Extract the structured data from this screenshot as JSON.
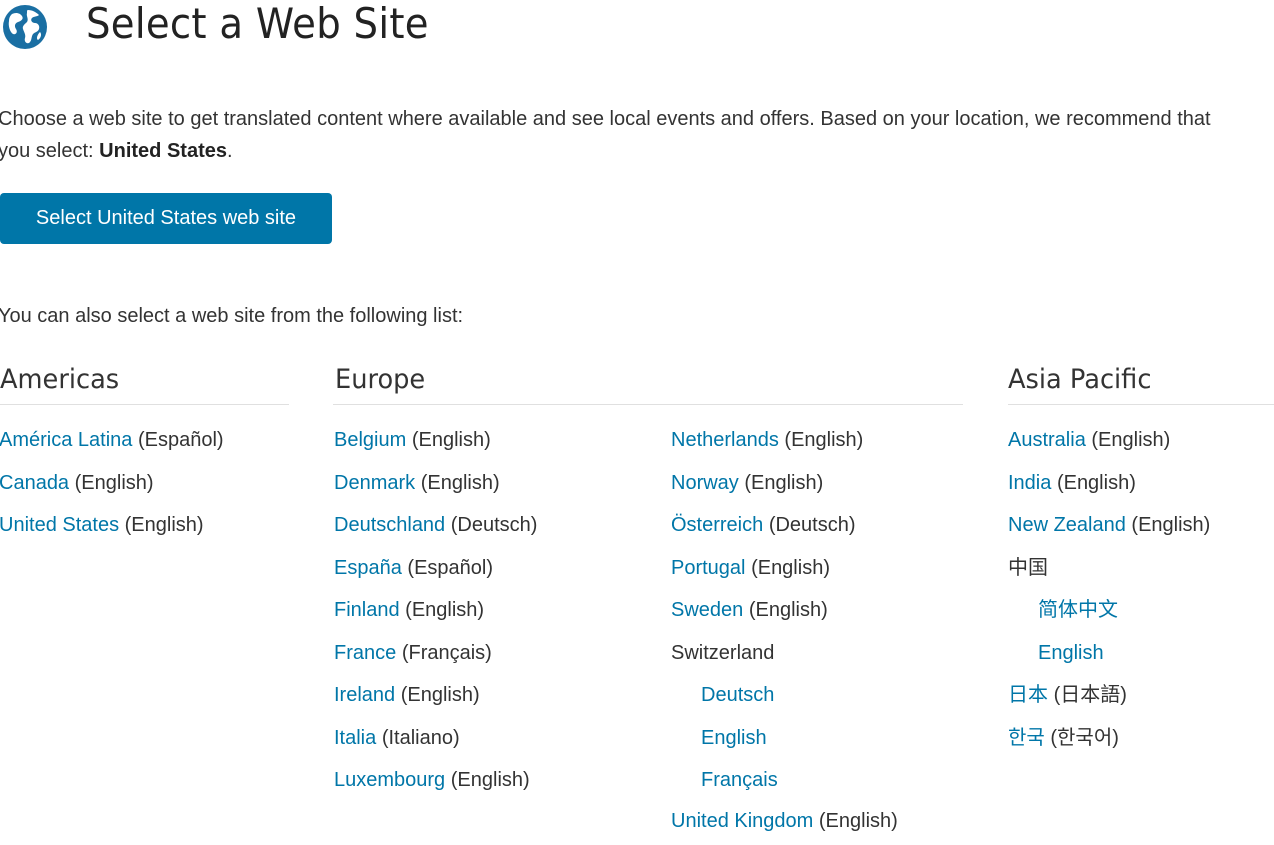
{
  "header": {
    "title": "Select a Web Site",
    "icon": "globe-icon"
  },
  "intro": {
    "text_before": "Choose a web site to get translated content where available and see local events and offers. Based on your location, we recommend that you select: ",
    "recommended": "United States",
    "text_after": "."
  },
  "primary_button": {
    "label": "Select United States web site"
  },
  "list_intro": "You can also select a web site from the following list:",
  "regions": {
    "americas": {
      "title": "Americas",
      "items": [
        {
          "site": "América Latina",
          "lang": "(Español)"
        },
        {
          "site": "Canada",
          "lang": "(English)"
        },
        {
          "site": "United States",
          "lang": "(English)"
        }
      ]
    },
    "europe": {
      "title": "Europe",
      "col1": [
        {
          "site": "Belgium",
          "lang": "(English)"
        },
        {
          "site": "Denmark",
          "lang": "(English)"
        },
        {
          "site": "Deutschland",
          "lang": "(Deutsch)"
        },
        {
          "site": "España",
          "lang": "(Español)"
        },
        {
          "site": "Finland",
          "lang": "(English)"
        },
        {
          "site": "France",
          "lang": "(Français)"
        },
        {
          "site": "Ireland",
          "lang": "(English)"
        },
        {
          "site": "Italia",
          "lang": "(Italiano)"
        },
        {
          "site": "Luxembourg",
          "lang": "(English)"
        }
      ],
      "col2": [
        {
          "site": "Netherlands",
          "lang": "(English)"
        },
        {
          "site": "Norway",
          "lang": "(English)"
        },
        {
          "site": "Österreich",
          "lang": "(Deutsch)"
        },
        {
          "site": "Portugal",
          "lang": "(English)"
        },
        {
          "site": "Sweden",
          "lang": "(English)"
        }
      ],
      "switzerland": {
        "label": "Switzerland",
        "options": [
          "Deutsch",
          "English",
          "Français"
        ]
      },
      "uk": {
        "site": "United Kingdom",
        "lang": "(English)"
      }
    },
    "asia_pacific": {
      "title": "Asia Pacific",
      "items": [
        {
          "site": "Australia",
          "lang": "(English)"
        },
        {
          "site": "India",
          "lang": "(English)"
        },
        {
          "site": "New Zealand",
          "lang": "(English)"
        }
      ],
      "china": {
        "label": "中国",
        "options": [
          "简体中文",
          "English"
        ]
      },
      "items2": [
        {
          "site": "日本",
          "lang": "(日本語)"
        },
        {
          "site": "한국",
          "lang": "(한국어)"
        }
      ]
    }
  },
  "colors": {
    "link": "#0076a8",
    "button": "#0076a8",
    "text": "#333333"
  }
}
